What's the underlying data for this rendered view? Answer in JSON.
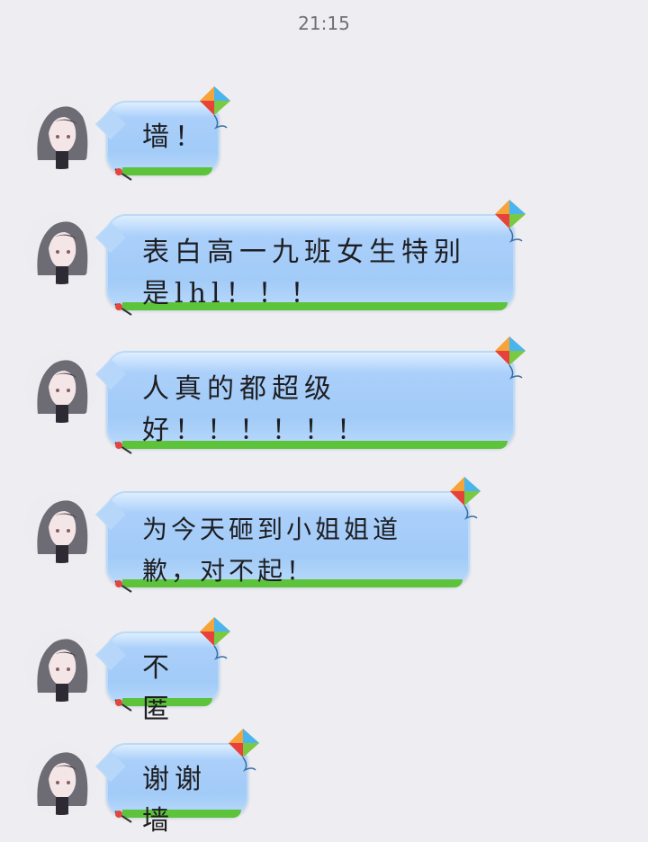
{
  "status": {
    "time": "21:15"
  },
  "messages": [
    {
      "text": "墙！"
    },
    {
      "text": "表白高一九班女生特别是lhl！！！"
    },
    {
      "text": "人真的都超级好！！！！！！"
    },
    {
      "text": "为今天砸到小姐姐道歉，对不起！"
    },
    {
      "text": "不匿"
    },
    {
      "text": "谢谢墙"
    }
  ],
  "colors": {
    "bubble": "#a2cbf7",
    "grass": "#5cc33a",
    "background": "#eeeef2"
  },
  "icons": {
    "bubble_decoration": "kite-icon",
    "avatar": "anime-girl-avatar"
  }
}
